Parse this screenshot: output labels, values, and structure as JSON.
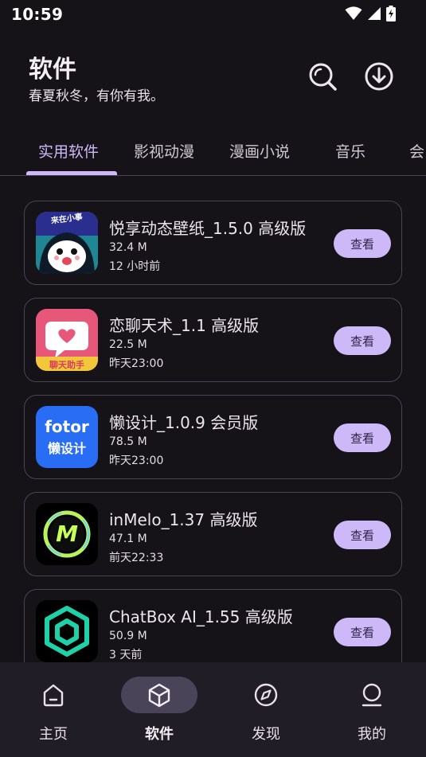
{
  "status_bar": {
    "time": "10:59"
  },
  "header": {
    "title": "软件",
    "subtitle": "春夏秋冬，有你有我。",
    "search_icon": "search-icon",
    "download_icon": "download-icon"
  },
  "tabs": [
    {
      "label": "实用软件",
      "active": true
    },
    {
      "label": "影视动漫",
      "active": false
    },
    {
      "label": "漫画小说",
      "active": false
    },
    {
      "label": "音乐",
      "active": false
    },
    {
      "label": "会",
      "active": false
    }
  ],
  "apps": [
    {
      "title": "悦享动态壁纸_1.5.0 高级版",
      "size": "32.4 M",
      "time": "12 小时前",
      "button": "查看",
      "icon": "wallpaper-app-icon",
      "icon_badge": "来在小事"
    },
    {
      "title": "恋聊天术_1.1 高级版",
      "size": "22.5 M",
      "time": "昨天23:00",
      "button": "查看",
      "icon": "chat-bubble-app-icon",
      "icon_badge": "聊天助手"
    },
    {
      "title": "懒设计_1.0.9 会员版",
      "size": "78.5 M",
      "time": "昨天23:00",
      "button": "查看",
      "icon": "fotor-app-icon",
      "icon_line1": "fotor",
      "icon_line2": "懒设计"
    },
    {
      "title": "inMelo_1.37 高级版",
      "size": "47.1 M",
      "time": "前天22:33",
      "button": "查看",
      "icon": "inmelo-app-icon",
      "icon_letter": "M"
    },
    {
      "title": "ChatBox AI_1.55 高级版",
      "size": "50.9 M",
      "time": "3 天前",
      "button": "查看",
      "icon": "chatbox-app-icon"
    }
  ],
  "bottom_nav": [
    {
      "label": "主页",
      "icon": "home-icon",
      "active": false
    },
    {
      "label": "软件",
      "icon": "cube-icon",
      "active": true
    },
    {
      "label": "发现",
      "icon": "compass-icon",
      "active": false
    },
    {
      "label": "我的",
      "icon": "profile-icon",
      "active": false
    }
  ],
  "colors": {
    "background": "#151218",
    "accent": "#cdb9f8",
    "nav_background": "#211d26",
    "active_pill": "#4a4458"
  }
}
